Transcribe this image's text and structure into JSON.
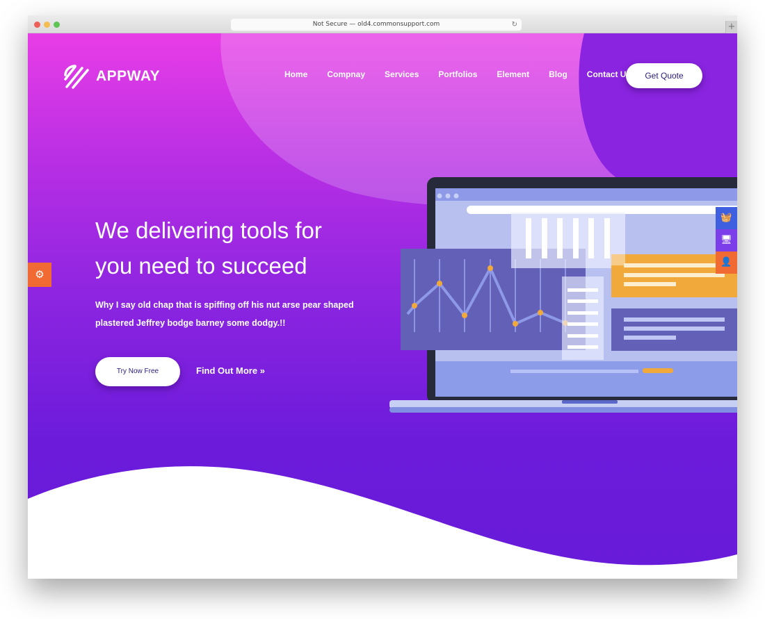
{
  "browser": {
    "url": "Not Secure — old4.commonsupport.com",
    "traffic_colors": [
      "#ee5f57",
      "#f5bd4f",
      "#5fc454"
    ]
  },
  "brand": {
    "name": "APPWAY"
  },
  "nav": {
    "items": [
      "Home",
      "Compnay",
      "Services",
      "Portfolios",
      "Element",
      "Blog",
      "Contact Us"
    ],
    "cta": "Get Quote"
  },
  "hero": {
    "title_line1": "We delivering tools for",
    "title_line2": "you need to succeed",
    "subtitle_line1": "Why I say old chap that is spiffing off his nut arse pear shaped",
    "subtitle_line2": "plastered Jeffrey bodge barney some dodgy.!!",
    "primary_button": "Try Now Free",
    "secondary_button": "Find Out More"
  },
  "widgets": {
    "settings_icon": "gear-icon",
    "side_icons": [
      {
        "icon": "basket-icon",
        "color": "#3e5fe0"
      },
      {
        "icon": "monitor-icon",
        "color": "#7b3ee8"
      },
      {
        "icon": "user-icon",
        "color": "#f26a33"
      }
    ]
  },
  "colors": {
    "gradient_top": "#e83de6",
    "gradient_bottom": "#681bd9",
    "accent_orange": "#f2a93b"
  }
}
